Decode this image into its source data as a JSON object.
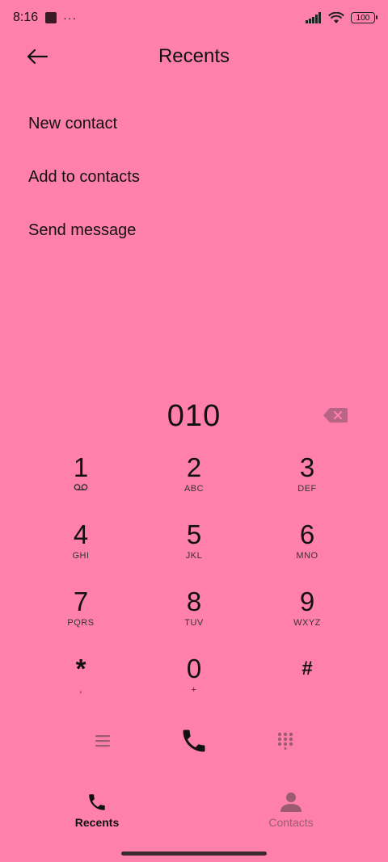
{
  "status_bar": {
    "time": "8:16",
    "overflow": "···",
    "battery": "100"
  },
  "header": {
    "title": "Recents",
    "back_icon": "back-arrow-icon"
  },
  "menu": [
    {
      "label": "New contact"
    },
    {
      "label": "Add to contacts"
    },
    {
      "label": "Send message"
    }
  ],
  "dialer": {
    "number": "010",
    "keys": [
      {
        "digit": "1",
        "letters": ""
      },
      {
        "digit": "2",
        "letters": "ABC"
      },
      {
        "digit": "3",
        "letters": "DEF"
      },
      {
        "digit": "4",
        "letters": "GHI"
      },
      {
        "digit": "5",
        "letters": "JKL"
      },
      {
        "digit": "6",
        "letters": "MNO"
      },
      {
        "digit": "7",
        "letters": "PQRS"
      },
      {
        "digit": "8",
        "letters": "TUV"
      },
      {
        "digit": "9",
        "letters": "WXYZ"
      },
      {
        "digit": "*",
        "letters": ","
      },
      {
        "digit": "0",
        "letters": "+"
      },
      {
        "digit": "#",
        "letters": ""
      }
    ]
  },
  "bottom_nav": {
    "tabs": [
      {
        "label": "Recents",
        "active": true
      },
      {
        "label": "Contacts",
        "active": false
      }
    ]
  },
  "colors": {
    "background": "#FF80AB",
    "muted_icon": "#9c5b73",
    "text": "#111111"
  }
}
